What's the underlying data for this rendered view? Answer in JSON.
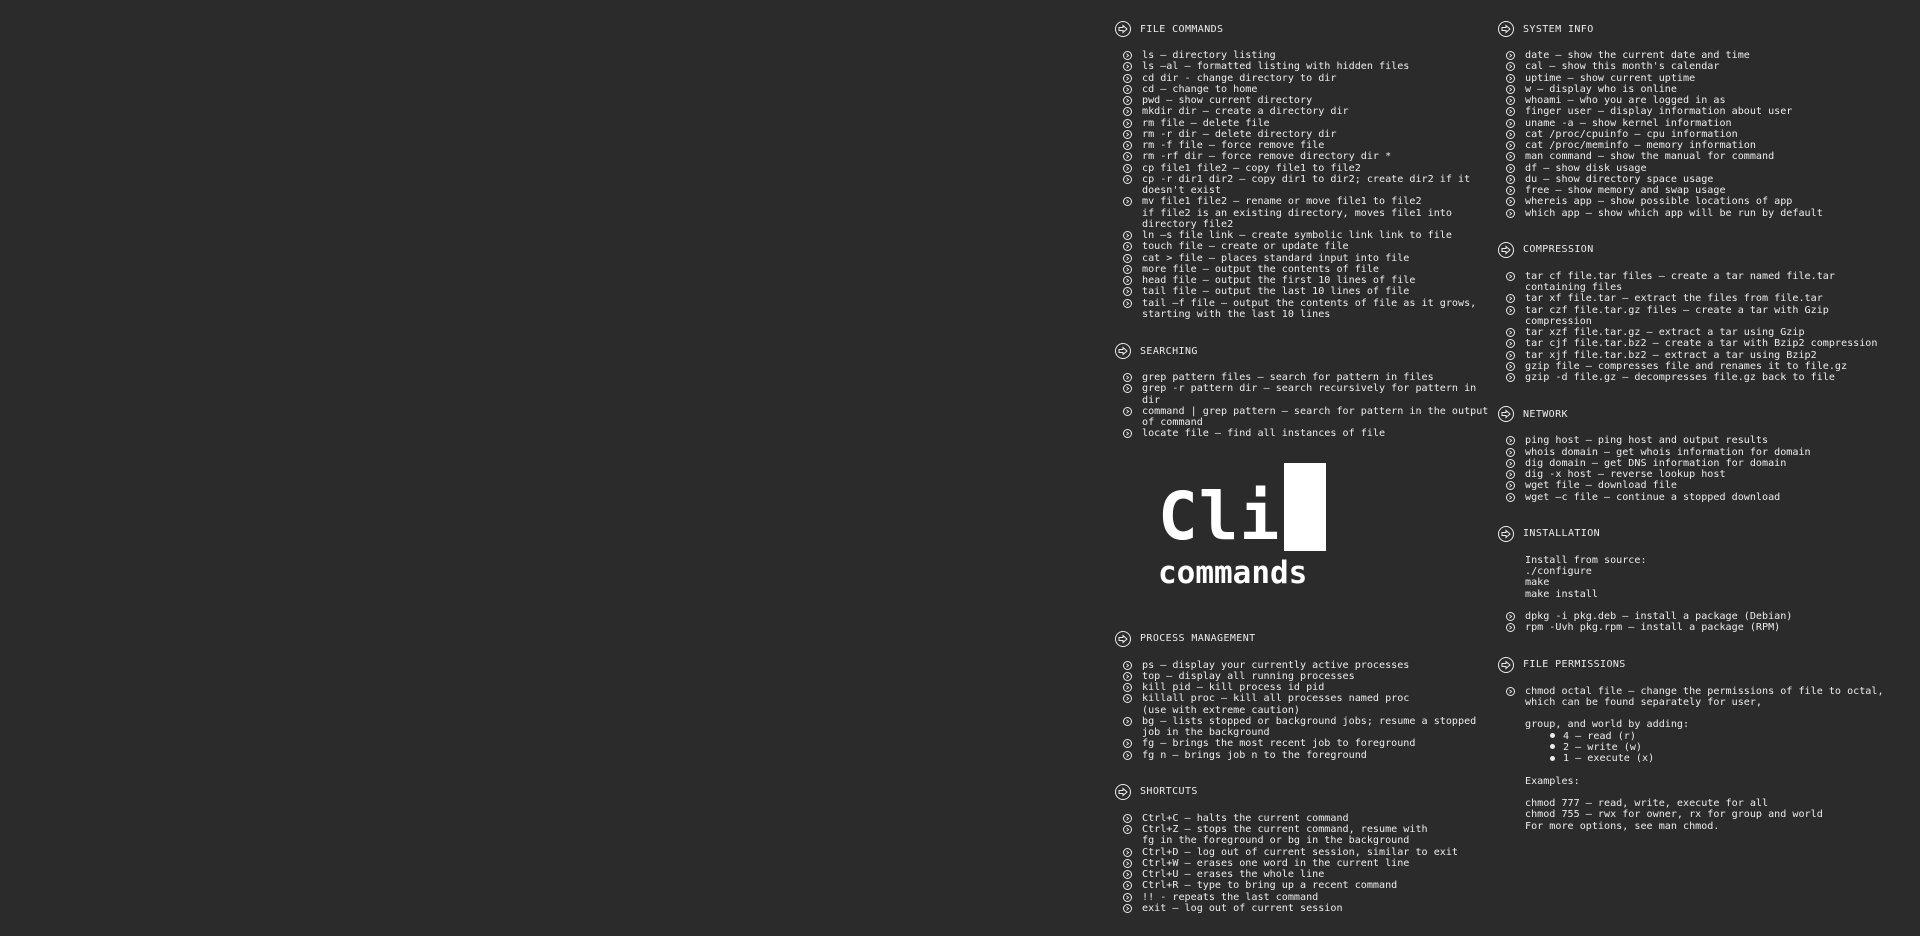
{
  "logo": {
    "title": "Cli",
    "subtitle": "commands"
  },
  "left_sections": [
    {
      "title": "FILE COMMANDS",
      "items": [
        "ls – directory listing",
        "ls –al – formatted listing with hidden files",
        "cd dir - change directory to dir",
        "cd – change to home",
        "pwd – show current directory",
        "mkdir dir – create a directory dir",
        "rm file – delete file",
        "rm -r dir – delete directory dir",
        "rm -f file – force remove file",
        "rm -rf dir – force remove directory dir *",
        "cp file1 file2 – copy file1 to file2",
        "cp -r dir1 dir2 – copy dir1 to dir2; create dir2 if it doesn't exist",
        "mv file1 file2 – rename or move file1 to file2\nif file2 is an existing directory, moves file1 into directory file2",
        "ln –s file link – create symbolic link link to file",
        "touch file – create or update file",
        "cat > file – places standard input into file",
        "more file – output the contents of file",
        "head file – output the first 10 lines of file",
        "tail file – output the last 10 lines of file",
        "tail –f file – output the contents of file as it grows, starting with the last 10 lines"
      ]
    },
    {
      "title": "SEARCHING",
      "items": [
        "grep pattern files – search for pattern in files",
        "grep -r pattern dir – search recursively for pattern in dir",
        "command | grep pattern – search for pattern in the output of command",
        "locate file – find all instances of file"
      ]
    },
    {
      "title": "PROCESS MANAGEMENT",
      "items": [
        "ps – display your currently active processes",
        "top – display all running processes",
        "kill pid – kill process id pid",
        "killall proc – kill all processes named proc\n(use with extreme caution)",
        "bg – lists stopped or background jobs; resume a stopped job in the background",
        "fg – brings the most recent job to foreground",
        "fg n – brings job n to the foreground"
      ]
    },
    {
      "title": "SHORTCUTS",
      "items": [
        "Ctrl+C – halts the current command",
        "Ctrl+Z – stops the current command, resume with\nfg in the foreground or bg in the background",
        "Ctrl+D – log out of current session, similar to exit",
        "Ctrl+W – erases one word in the current line",
        "Ctrl+U – erases the whole line",
        "Ctrl+R – type to bring up a recent command",
        "!! - repeats the last command",
        "exit – log out of current session"
      ]
    }
  ],
  "right_sections": [
    {
      "title": "SYSTEM INFO",
      "items": [
        "date – show the current date and time",
        "cal – show this month's calendar",
        "uptime – show current uptime",
        "w – display who is online",
        "whoami – who you are logged in as",
        "finger user – display information about user",
        "uname -a – show kernel information",
        "cat /proc/cpuinfo – cpu information",
        "cat /proc/meminfo – memory information",
        "man command – show the manual for command",
        "df – show disk usage",
        "du – show directory space usage",
        "free – show memory and swap usage",
        "whereis app – show possible locations of app",
        "which app – show which app will be run by default"
      ]
    },
    {
      "title": "COMPRESSION",
      "items": [
        "tar cf file.tar files – create a tar named file.tar containing files",
        "tar xf file.tar – extract the files from file.tar",
        "tar czf file.tar.gz files – create a tar with Gzip compression",
        "tar xzf file.tar.gz – extract a tar using Gzip",
        "tar cjf file.tar.bz2 – create a tar with Bzip2 compression",
        "tar xjf file.tar.bz2 – extract a tar using Bzip2",
        "gzip file – compresses file and renames it to file.gz",
        "gzip -d file.gz – decompresses file.gz back to file"
      ]
    },
    {
      "title": "NETWORK",
      "items": [
        "ping host – ping host and output results",
        "whois domain – get whois information for domain",
        "dig domain – get DNS information for domain",
        "dig -x host – reverse lookup host",
        "wget file – download file",
        "wget –c file – continue a stopped download"
      ]
    },
    {
      "title": "INSTALLATION",
      "install_label": "Install from source:",
      "install_steps": [
        "./configure",
        "make",
        "make install"
      ],
      "items": [
        "dpkg -i pkg.deb – install a package (Debian)",
        "rpm -Uvh pkg.rpm – install a package (RPM)"
      ]
    },
    {
      "title": "FILE PERMISSIONS",
      "items": [
        "chmod octal file – change the permissions of file to octal, which can be found separately for user,"
      ],
      "group_text": "group, and world by adding:",
      "bits": [
        "4 – read (r)",
        "2 – write (w)",
        "1 – execute (x)"
      ],
      "examples_label": "Examples:",
      "examples": [
        "chmod 777 – read, write, execute for all",
        "chmod 755 – rwx for owner, rx for group and world",
        "For more options, see man chmod."
      ]
    }
  ]
}
